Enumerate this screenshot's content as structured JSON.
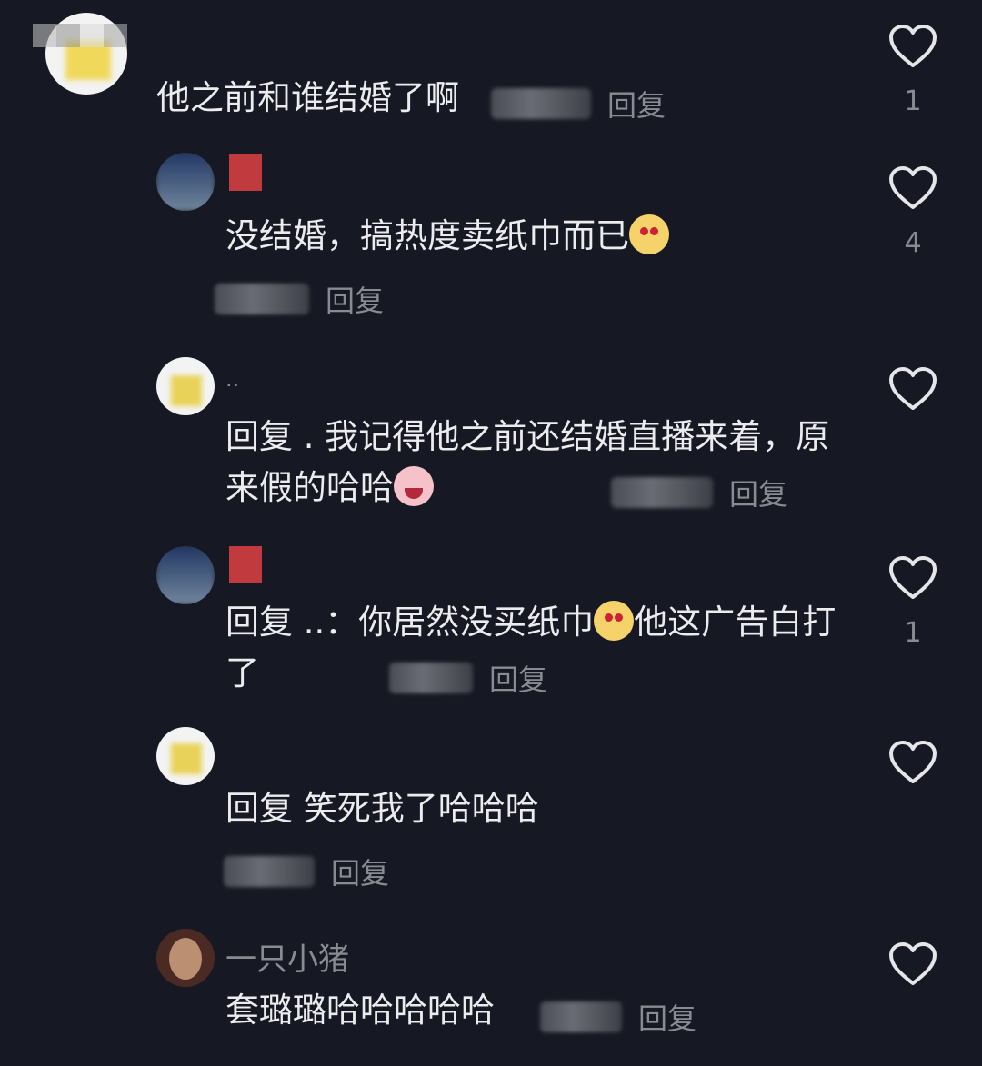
{
  "comments": [
    {
      "text": "他之前和谁结婚了啊",
      "reply": "回复",
      "likes": "1"
    },
    {
      "text": "没结婚，搞热度卖纸巾而已",
      "reply": "回复",
      "likes": "4"
    },
    {
      "name": "..",
      "text": "回复 . 我记得他之前还结婚直播来着，原来假的哈哈",
      "reply": "回复",
      "likes": ""
    },
    {
      "text": "回复 ..：你居然没买纸巾",
      "text2": "他这广告白打了",
      "reply": "回复",
      "likes": "1"
    },
    {
      "text": "回复  笑死我了哈哈哈",
      "reply": "回复",
      "likes": ""
    },
    {
      "name": "一只小猪",
      "text": "套璐璐哈哈哈哈哈",
      "reply": "回复",
      "likes": ""
    }
  ],
  "icons": {
    "like": "heart-outline-icon"
  },
  "colors": {
    "background": "#161823",
    "muted": "#8a8b92",
    "text": "#ececee"
  }
}
